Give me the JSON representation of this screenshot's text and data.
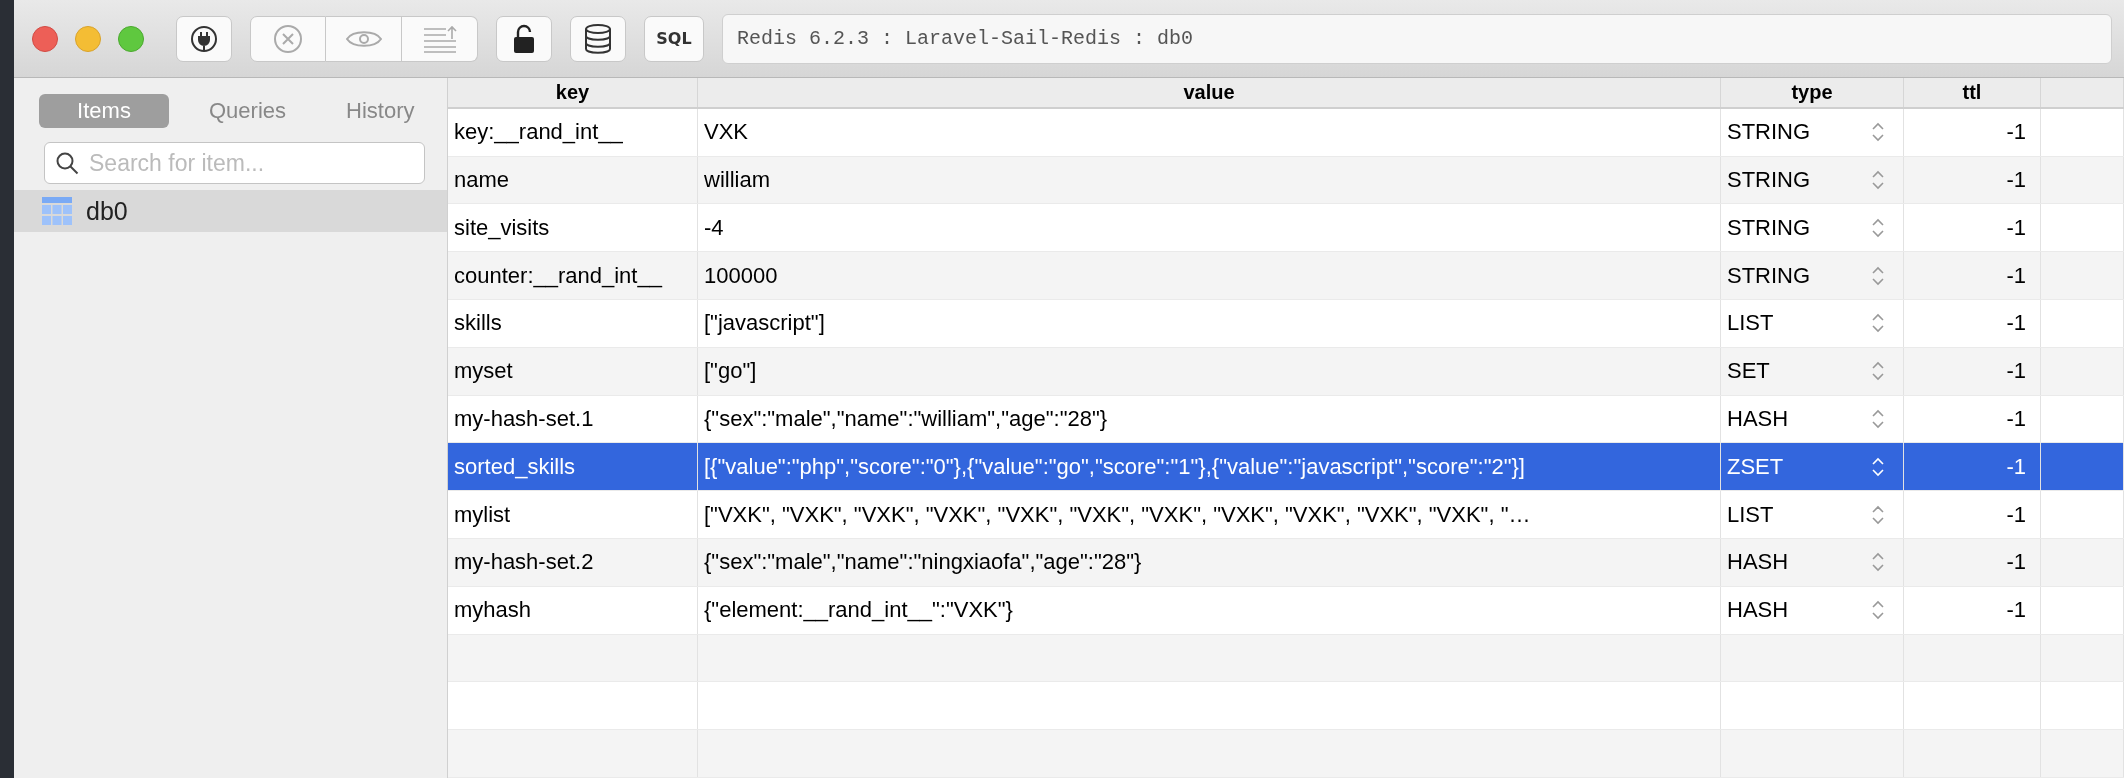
{
  "window": {
    "title": "Redis 6.2.3 : Laravel-Sail-Redis : db0"
  },
  "toolbar": {
    "sql_button": "SQL"
  },
  "sidebar": {
    "tabs": [
      {
        "label": "Items",
        "selected": true
      },
      {
        "label": "Queries",
        "selected": false
      },
      {
        "label": "History",
        "selected": false
      }
    ],
    "search": {
      "placeholder": "Search for item..."
    },
    "items": [
      {
        "label": "db0",
        "selected": true
      }
    ]
  },
  "table": {
    "columns": [
      "key",
      "value",
      "type",
      "ttl"
    ],
    "rows": [
      {
        "key": "key:__rand_int__",
        "value": "VXK",
        "type": "STRING",
        "ttl": "-1",
        "selected": false
      },
      {
        "key": "name",
        "value": "william",
        "type": "STRING",
        "ttl": "-1",
        "selected": false
      },
      {
        "key": "site_visits",
        "value": "-4",
        "type": "STRING",
        "ttl": "-1",
        "selected": false
      },
      {
        "key": "counter:__rand_int__",
        "value": "100000",
        "type": "STRING",
        "ttl": "-1",
        "selected": false
      },
      {
        "key": "skills",
        "value": "[\"javascript\"]",
        "type": "LIST",
        "ttl": "-1",
        "selected": false
      },
      {
        "key": "myset",
        "value": "[\"go\"]",
        "type": "SET",
        "ttl": "-1",
        "selected": false
      },
      {
        "key": "my-hash-set.1",
        "value": "{\"sex\":\"male\",\"name\":\"william\",\"age\":\"28\"}",
        "type": "HASH",
        "ttl": "-1",
        "selected": false
      },
      {
        "key": "sorted_skills",
        "value": "[{\"value\":\"php\",\"score\":\"0\"},{\"value\":\"go\",\"score\":\"1\"},{\"value\":\"javascript\",\"score\":\"2\"}]",
        "type": "ZSET",
        "ttl": "-1",
        "selected": true
      },
      {
        "key": "mylist",
        "value": "[\"VXK\", \"VXK\", \"VXK\", \"VXK\", \"VXK\", \"VXK\", \"VXK\", \"VXK\", \"VXK\", \"VXK\", \"VXK\", \"…",
        "type": "LIST",
        "ttl": "-1",
        "selected": false
      },
      {
        "key": "my-hash-set.2",
        "value": "{\"sex\":\"male\",\"name\":\"ningxiaofa\",\"age\":\"28\"}",
        "type": "HASH",
        "ttl": "-1",
        "selected": false
      },
      {
        "key": "myhash",
        "value": "{\"element:__rand_int__\":\"VXK\"}",
        "type": "HASH",
        "ttl": "-1",
        "selected": false
      }
    ]
  }
}
